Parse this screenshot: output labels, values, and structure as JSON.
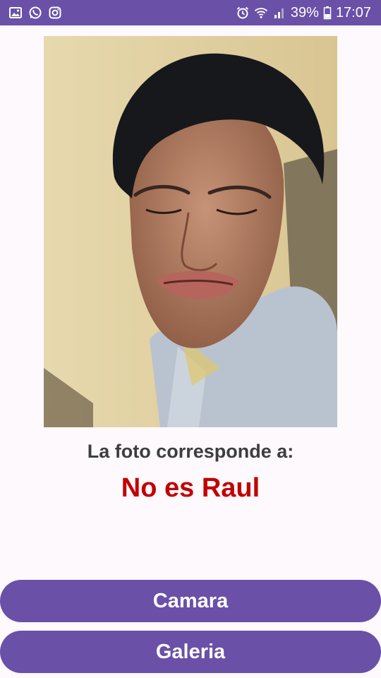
{
  "status_bar": {
    "battery": "39%",
    "time": "17:07",
    "left_icons": [
      "gallery-icon",
      "whatsapp-icon",
      "instagram-icon"
    ],
    "right_icons": [
      "alarm-icon",
      "wifi-icon",
      "signal-icon",
      "battery-icon"
    ]
  },
  "main": {
    "caption": "La foto corresponde a:",
    "result": "No es Raul",
    "result_color": "#c20000"
  },
  "buttons": {
    "camera_label": "Camara",
    "gallery_label": "Galeria"
  },
  "colors": {
    "accent": "#6a50a7",
    "background": "#fdf9fd"
  }
}
